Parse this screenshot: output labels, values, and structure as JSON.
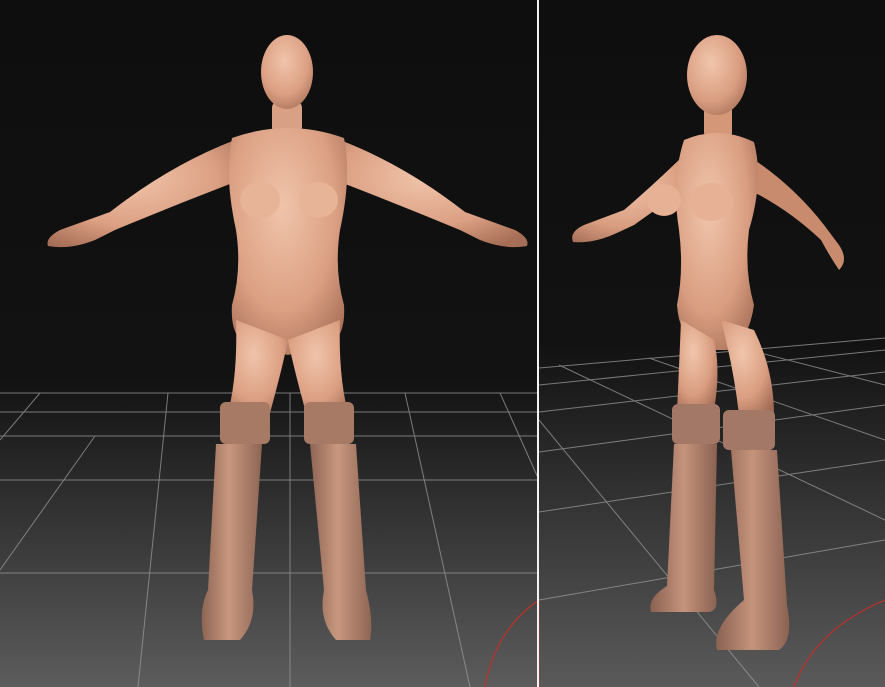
{
  "scene": {
    "views": [
      {
        "id": "front",
        "description_icon": "front-view-model"
      },
      {
        "id": "three-quarter",
        "description_icon": "three-quarter-view-model"
      }
    ],
    "colors": {
      "background_top": "#0e0e0e",
      "floor_bottom": "#5a5a5a",
      "grid_line": "#9a9a9a",
      "skin_light": "#e9b89d",
      "skin_mid": "#d49878",
      "skin_dark": "#9d6a55",
      "boot": "#b88a74",
      "boot_dark": "#8d6554",
      "axis_red": "#c0302a",
      "divider": "#f2f2f2"
    }
  }
}
